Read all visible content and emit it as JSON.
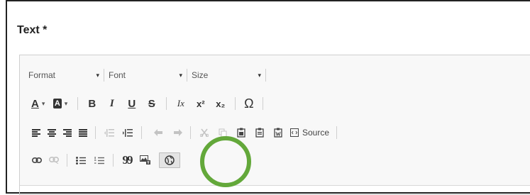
{
  "field": {
    "label": "Text *"
  },
  "toolbar": {
    "row1": {
      "format_label": "Format",
      "font_label": "Font",
      "size_label": "Size",
      "arrow": "▾"
    },
    "row2": {
      "text_color": "A",
      "bg_color": "A",
      "bold": "B",
      "italic": "I",
      "underline": "U",
      "strike": "S",
      "remove_format": "Ix",
      "superscript": "x²",
      "subscript": "x₂",
      "special_char": "Ω"
    },
    "row3": {
      "source_label": "Source"
    },
    "row4": {
      "blockquote": "99"
    }
  },
  "colors": {
    "highlight": "#63a83a"
  }
}
